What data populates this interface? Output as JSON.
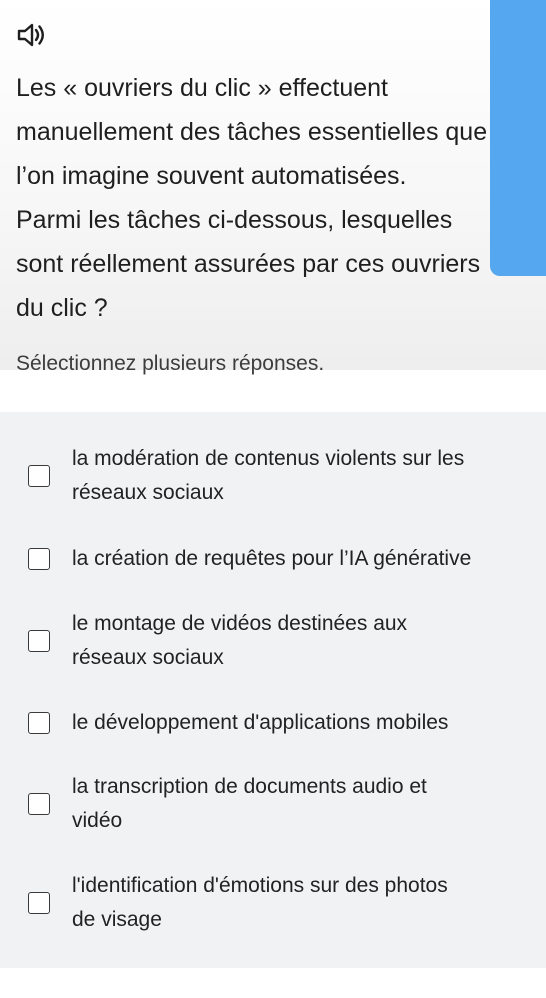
{
  "audio": {
    "icon": "speaker-icon"
  },
  "question": {
    "lines": [
      "Les « ouvriers du clic » effectuent",
      "manuellement des tâches essentielles que",
      "l’on imagine souvent automatisées.",
      "Parmi les tâches ci-dessous, lesquelles",
      "sont réellement assurées par ces ouvriers",
      "du clic ?"
    ]
  },
  "instruction": "Sélectionnez plusieurs réponses.",
  "options": [
    {
      "lines": [
        "la modération de contenus violents sur les",
        "réseaux sociaux"
      ],
      "checked": false
    },
    {
      "lines": [
        "la création de requêtes pour l’IA générative"
      ],
      "checked": false
    },
    {
      "lines": [
        "le montage de vidéos destinées aux",
        "réseaux sociaux"
      ],
      "checked": false
    },
    {
      "lines": [
        "le développement d'applications mobiles"
      ],
      "checked": false
    },
    {
      "lines": [
        "la transcription de documents audio et",
        "vidéo"
      ],
      "checked": false
    },
    {
      "lines": [
        "l'identification d'émotions sur des photos",
        "de visage"
      ],
      "checked": false
    }
  ],
  "colors": {
    "accent": "#55a8f0",
    "panel": "#f1f2f4"
  }
}
